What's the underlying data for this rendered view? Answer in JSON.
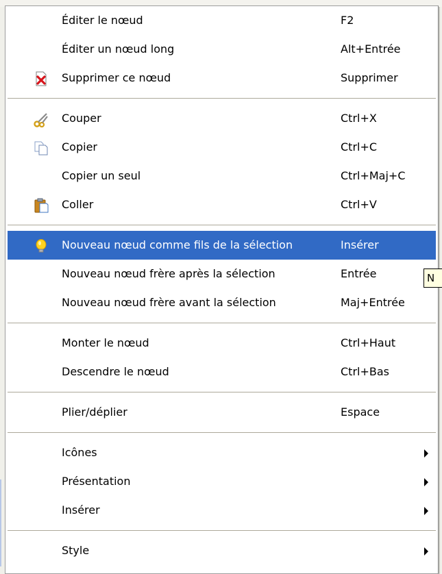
{
  "menu": {
    "items": [
      {
        "type": "item",
        "name": "menu-item-edit-node",
        "label": "Éditer le nœud",
        "shortcut": "F2"
      },
      {
        "type": "item",
        "name": "menu-item-edit-long-node",
        "label": "Éditer un nœud long",
        "shortcut": "Alt+Entrée"
      },
      {
        "type": "item",
        "name": "menu-item-delete-node",
        "label": "Supprimer ce nœud",
        "shortcut": "Supprimer",
        "icon": "delete-icon"
      },
      {
        "type": "separator"
      },
      {
        "type": "item",
        "name": "menu-item-cut",
        "label": "Couper",
        "shortcut": "Ctrl+X",
        "icon": "scissors-icon"
      },
      {
        "type": "item",
        "name": "menu-item-copy",
        "label": "Copier",
        "shortcut": "Ctrl+C",
        "icon": "copy-icon"
      },
      {
        "type": "item",
        "name": "menu-item-copy-single",
        "label": "Copier un seul",
        "shortcut": "Ctrl+Maj+C"
      },
      {
        "type": "item",
        "name": "menu-item-paste",
        "label": "Coller",
        "shortcut": "Ctrl+V",
        "icon": "clipboard-icon"
      },
      {
        "type": "separator"
      },
      {
        "type": "item",
        "name": "menu-item-new-child-node",
        "label": "Nouveau nœud comme fils de la sélection",
        "shortcut": "Insérer",
        "icon": "lightbulb-icon",
        "selected": true
      },
      {
        "type": "item",
        "name": "menu-item-new-sibling-after",
        "label": "Nouveau nœud frère après la sélection",
        "shortcut": "Entrée"
      },
      {
        "type": "item",
        "name": "menu-item-new-sibling-before",
        "label": "Nouveau nœud frère avant la sélection",
        "shortcut": "Maj+Entrée"
      },
      {
        "type": "separator"
      },
      {
        "type": "item",
        "name": "menu-item-move-up",
        "label": "Monter le nœud",
        "shortcut": "Ctrl+Haut"
      },
      {
        "type": "item",
        "name": "menu-item-move-down",
        "label": "Descendre le nœud",
        "shortcut": "Ctrl+Bas"
      },
      {
        "type": "separator"
      },
      {
        "type": "item",
        "name": "menu-item-fold-unfold",
        "label": "Plier/déplier",
        "shortcut": "Espace"
      },
      {
        "type": "separator"
      },
      {
        "type": "item",
        "name": "menu-item-icons",
        "label": "Icônes",
        "submenu": true
      },
      {
        "type": "item",
        "name": "menu-item-presentation",
        "label": "Présentation",
        "submenu": true
      },
      {
        "type": "item",
        "name": "menu-item-insert",
        "label": "Insérer",
        "submenu": true
      },
      {
        "type": "separator"
      },
      {
        "type": "item",
        "name": "menu-item-style",
        "label": "Style",
        "submenu": true
      }
    ]
  },
  "tooltip": {
    "text": "N"
  },
  "colors": {
    "selection": "#316ac5",
    "separator": "#aca899",
    "tooltip_bg": "#ffffe1"
  }
}
